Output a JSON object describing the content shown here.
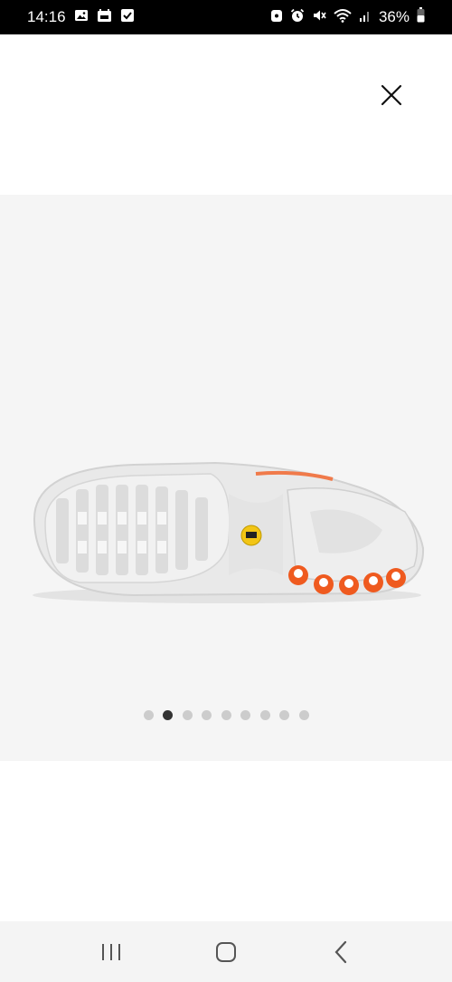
{
  "status_bar": {
    "time": "14:16",
    "battery": "36%"
  },
  "gallery": {
    "image_count": 9,
    "active_index": 1,
    "image_alt_icon": "shoe-sole-icon"
  },
  "colors": {
    "accent_orange": "#ef5a1f",
    "active_dot": "#333333",
    "inactive_dot": "#cccccc",
    "panel_bg": "#f5f5f5"
  }
}
